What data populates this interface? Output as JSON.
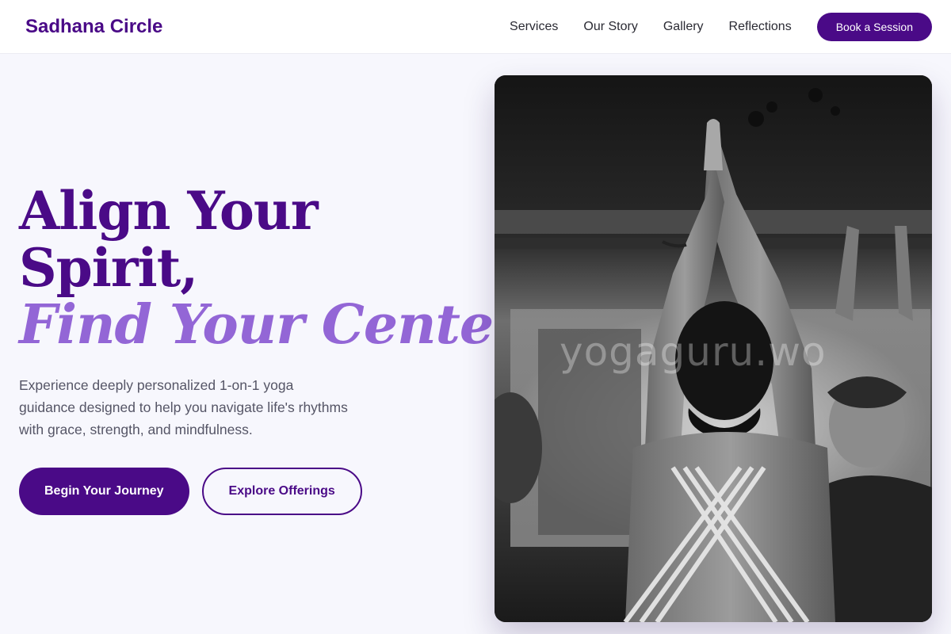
{
  "nav": {
    "brand": "Sadhana Circle",
    "links": [
      "Services",
      "Our Story",
      "Gallery",
      "Reflections"
    ],
    "cta": "Book a Session"
  },
  "hero": {
    "headline_line1": "Align Your",
    "headline_line2": "Spirit,",
    "headline_accent": "Find Your Center.",
    "subtext": "Experience deeply personalized 1-on-1 yoga guidance designed to help you navigate life's rhythms with grace, strength, and mindfulness.",
    "primary_button": "Begin Your Journey",
    "secondary_button": "Explore Offerings"
  },
  "image": {
    "watermark": "yogaguru.wo"
  },
  "colors": {
    "brand_purple": "#4a0a87",
    "accent_lavender": "#9366d6",
    "page_background": "#f7f7fd"
  }
}
